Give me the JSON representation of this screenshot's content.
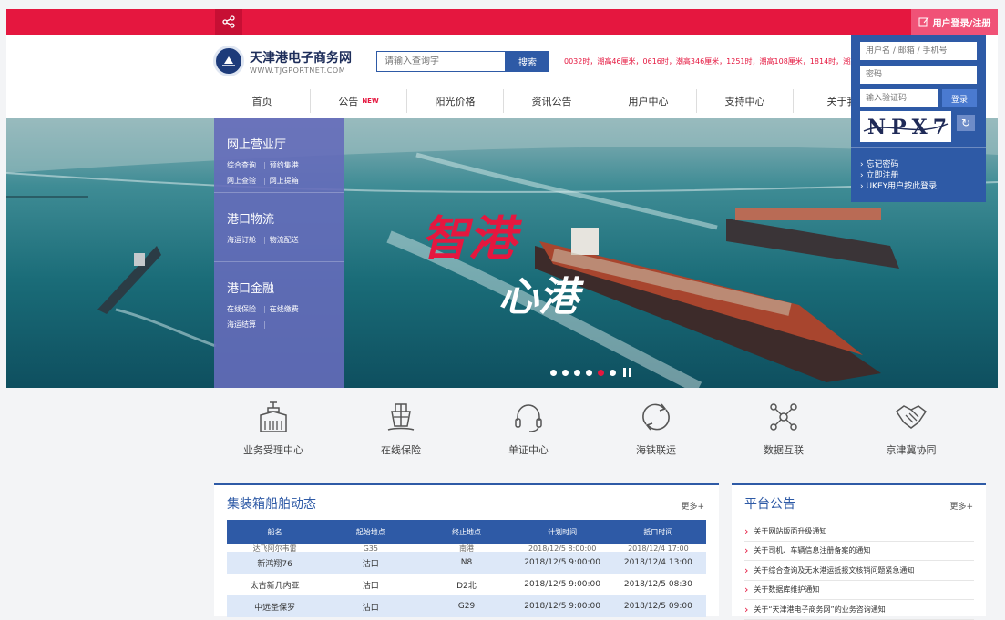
{
  "topbar": {
    "login_label": "用户登录/注册"
  },
  "header": {
    "logo_title": "天津港电子商务网",
    "logo_sub": "WWW.TJGPORTNET.COM",
    "search_placeholder": "请输入查询字",
    "search_button": "搜索",
    "ticker": "0032时，潮高46厘米，0616时，潮高346厘米，1251时，潮高108厘米，1814时，潮高"
  },
  "nav": [
    {
      "label": "首页",
      "badge": ""
    },
    {
      "label": "公告",
      "badge": "NEW"
    },
    {
      "label": "阳光价格",
      "badge": ""
    },
    {
      "label": "资讯公告",
      "badge": ""
    },
    {
      "label": "用户中心",
      "badge": ""
    },
    {
      "label": "支持中心",
      "badge": ""
    },
    {
      "label": "关于我",
      "badge": ""
    }
  ],
  "login": {
    "user_placeholder": "用户名 / 邮箱 / 手机号",
    "password_placeholder": "密码",
    "captcha_placeholder": "输入验证码",
    "submit": "登录",
    "captcha_text": "NPX7",
    "links": [
      "› 忘记密码",
      "› 立即注册",
      "› UKEY用户按此登录"
    ]
  },
  "leftmenu": [
    {
      "title": "网上营业厅",
      "links": [
        [
          "综合查询",
          "预约集港"
        ],
        [
          "网上查验",
          "网上提箱"
        ]
      ]
    },
    {
      "title": "港口物流",
      "links": [
        [
          "海运订舱",
          "物流配送"
        ]
      ]
    },
    {
      "title": "港口金融",
      "links": [
        [
          "在线保险",
          "在线缴费"
        ],
        [
          "海运结算"
        ]
      ]
    }
  ],
  "banner": {
    "slogan_a": "智港",
    "slogan_b": "心港",
    "slides": 6,
    "active_slide": 5
  },
  "services": [
    {
      "label": "业务受理中心",
      "icon": "warehouse-icon"
    },
    {
      "label": "在线保险",
      "icon": "ship-icon"
    },
    {
      "label": "单证中心",
      "icon": "headset-icon"
    },
    {
      "label": "海铁联运",
      "icon": "cycle-icon"
    },
    {
      "label": "数据互联",
      "icon": "network-icon"
    },
    {
      "label": "京津冀协同",
      "icon": "handshake-icon"
    }
  ],
  "vessels": {
    "title": "集装箱船舶动态",
    "more": "更多+",
    "headers": [
      "船名",
      "起始地点",
      "终止地点",
      "计划时间",
      "抵口时间"
    ],
    "cut_row": [
      "达飞阿尔韦雷",
      "G35",
      "南港",
      "2018/12/5 8:00:00",
      "2018/12/4 17:00"
    ],
    "rows": [
      [
        "新鸿翔76",
        "沽口",
        "N8",
        "2018/12/5 9:00:00",
        "2018/12/4 13:00"
      ],
      [
        "太古新几内亚",
        "沽口",
        "D2北",
        "2018/12/5 9:00:00",
        "2018/12/5 08:30"
      ],
      [
        "中远圣保罗",
        "沽口",
        "G29",
        "2018/12/5 9:00:00",
        "2018/12/5 09:00"
      ]
    ]
  },
  "notices": {
    "title": "平台公告",
    "more": "更多+",
    "items": [
      "关于网站版面升级通知",
      "关于司机、车辆信息注册备案的通知",
      "关于综合查询及无水港运抵报文核销问题紧急通知",
      "关于数据库维护通知",
      "关于“天津港电子商务网”的业务咨询通知"
    ]
  },
  "colors": {
    "brand_red": "#e5173f",
    "brand_blue": "#2e5aa6",
    "menu_purple": "#656bba"
  }
}
